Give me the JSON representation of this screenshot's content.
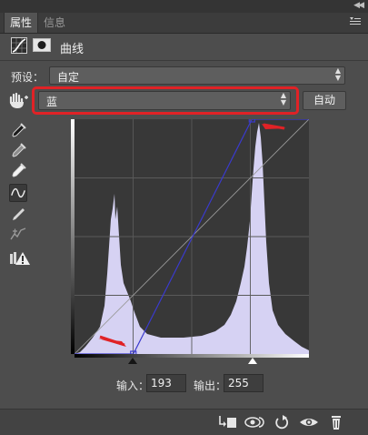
{
  "tabs": [
    {
      "label": "属性",
      "active": true
    },
    {
      "label": "信息",
      "active": false
    }
  ],
  "adjustment": {
    "title": "曲线"
  },
  "preset": {
    "label": "预设：",
    "value": "自定"
  },
  "channel": {
    "value": "蓝",
    "highlight_color": "#e02226"
  },
  "auto_button": {
    "label": "自动"
  },
  "tools": [
    "on-image-adjust-icon",
    "black-point-eyedropper-icon",
    "gray-point-eyedropper-icon",
    "white-point-eyedropper-icon",
    "curve-edit-icon",
    "pencil-draw-icon",
    "smooth-curve-icon",
    "clipping-warning-icon"
  ],
  "curve": {
    "channel_color": "#3a3acc",
    "points": [
      {
        "input": 0,
        "output": 0
      },
      {
        "input": 64,
        "output": 0
      },
      {
        "input": 193,
        "output": 255
      },
      {
        "input": 255,
        "output": 255
      }
    ],
    "histogram_color": "#d6d2f3"
  },
  "io": {
    "input_label": "输入：",
    "input_value": "193",
    "output_label": "输出：",
    "output_value": "255"
  },
  "bottom_toolbar": [
    "clip-to-layer-icon",
    "view-previous-icon",
    "reset-icon",
    "visibility-eye-icon",
    "delete-trash-icon"
  ]
}
